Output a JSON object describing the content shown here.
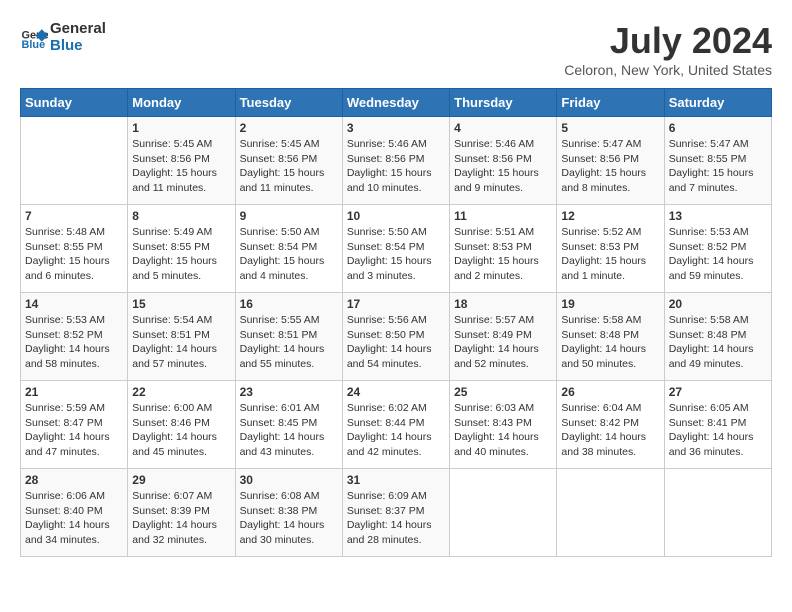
{
  "header": {
    "logo_line1": "General",
    "logo_line2": "Blue",
    "title": "July 2024",
    "location": "Celoron, New York, United States"
  },
  "weekdays": [
    "Sunday",
    "Monday",
    "Tuesday",
    "Wednesday",
    "Thursday",
    "Friday",
    "Saturday"
  ],
  "weeks": [
    [
      {
        "day": "",
        "sunrise": "",
        "sunset": "",
        "daylight": ""
      },
      {
        "day": "1",
        "sunrise": "Sunrise: 5:45 AM",
        "sunset": "Sunset: 8:56 PM",
        "daylight": "Daylight: 15 hours and 11 minutes."
      },
      {
        "day": "2",
        "sunrise": "Sunrise: 5:45 AM",
        "sunset": "Sunset: 8:56 PM",
        "daylight": "Daylight: 15 hours and 11 minutes."
      },
      {
        "day": "3",
        "sunrise": "Sunrise: 5:46 AM",
        "sunset": "Sunset: 8:56 PM",
        "daylight": "Daylight: 15 hours and 10 minutes."
      },
      {
        "day": "4",
        "sunrise": "Sunrise: 5:46 AM",
        "sunset": "Sunset: 8:56 PM",
        "daylight": "Daylight: 15 hours and 9 minutes."
      },
      {
        "day": "5",
        "sunrise": "Sunrise: 5:47 AM",
        "sunset": "Sunset: 8:56 PM",
        "daylight": "Daylight: 15 hours and 8 minutes."
      },
      {
        "day": "6",
        "sunrise": "Sunrise: 5:47 AM",
        "sunset": "Sunset: 8:55 PM",
        "daylight": "Daylight: 15 hours and 7 minutes."
      }
    ],
    [
      {
        "day": "7",
        "sunrise": "Sunrise: 5:48 AM",
        "sunset": "Sunset: 8:55 PM",
        "daylight": "Daylight: 15 hours and 6 minutes."
      },
      {
        "day": "8",
        "sunrise": "Sunrise: 5:49 AM",
        "sunset": "Sunset: 8:55 PM",
        "daylight": "Daylight: 15 hours and 5 minutes."
      },
      {
        "day": "9",
        "sunrise": "Sunrise: 5:50 AM",
        "sunset": "Sunset: 8:54 PM",
        "daylight": "Daylight: 15 hours and 4 minutes."
      },
      {
        "day": "10",
        "sunrise": "Sunrise: 5:50 AM",
        "sunset": "Sunset: 8:54 PM",
        "daylight": "Daylight: 15 hours and 3 minutes."
      },
      {
        "day": "11",
        "sunrise": "Sunrise: 5:51 AM",
        "sunset": "Sunset: 8:53 PM",
        "daylight": "Daylight: 15 hours and 2 minutes."
      },
      {
        "day": "12",
        "sunrise": "Sunrise: 5:52 AM",
        "sunset": "Sunset: 8:53 PM",
        "daylight": "Daylight: 15 hours and 1 minute."
      },
      {
        "day": "13",
        "sunrise": "Sunrise: 5:53 AM",
        "sunset": "Sunset: 8:52 PM",
        "daylight": "Daylight: 14 hours and 59 minutes."
      }
    ],
    [
      {
        "day": "14",
        "sunrise": "Sunrise: 5:53 AM",
        "sunset": "Sunset: 8:52 PM",
        "daylight": "Daylight: 14 hours and 58 minutes."
      },
      {
        "day": "15",
        "sunrise": "Sunrise: 5:54 AM",
        "sunset": "Sunset: 8:51 PM",
        "daylight": "Daylight: 14 hours and 57 minutes."
      },
      {
        "day": "16",
        "sunrise": "Sunrise: 5:55 AM",
        "sunset": "Sunset: 8:51 PM",
        "daylight": "Daylight: 14 hours and 55 minutes."
      },
      {
        "day": "17",
        "sunrise": "Sunrise: 5:56 AM",
        "sunset": "Sunset: 8:50 PM",
        "daylight": "Daylight: 14 hours and 54 minutes."
      },
      {
        "day": "18",
        "sunrise": "Sunrise: 5:57 AM",
        "sunset": "Sunset: 8:49 PM",
        "daylight": "Daylight: 14 hours and 52 minutes."
      },
      {
        "day": "19",
        "sunrise": "Sunrise: 5:58 AM",
        "sunset": "Sunset: 8:48 PM",
        "daylight": "Daylight: 14 hours and 50 minutes."
      },
      {
        "day": "20",
        "sunrise": "Sunrise: 5:58 AM",
        "sunset": "Sunset: 8:48 PM",
        "daylight": "Daylight: 14 hours and 49 minutes."
      }
    ],
    [
      {
        "day": "21",
        "sunrise": "Sunrise: 5:59 AM",
        "sunset": "Sunset: 8:47 PM",
        "daylight": "Daylight: 14 hours and 47 minutes."
      },
      {
        "day": "22",
        "sunrise": "Sunrise: 6:00 AM",
        "sunset": "Sunset: 8:46 PM",
        "daylight": "Daylight: 14 hours and 45 minutes."
      },
      {
        "day": "23",
        "sunrise": "Sunrise: 6:01 AM",
        "sunset": "Sunset: 8:45 PM",
        "daylight": "Daylight: 14 hours and 43 minutes."
      },
      {
        "day": "24",
        "sunrise": "Sunrise: 6:02 AM",
        "sunset": "Sunset: 8:44 PM",
        "daylight": "Daylight: 14 hours and 42 minutes."
      },
      {
        "day": "25",
        "sunrise": "Sunrise: 6:03 AM",
        "sunset": "Sunset: 8:43 PM",
        "daylight": "Daylight: 14 hours and 40 minutes."
      },
      {
        "day": "26",
        "sunrise": "Sunrise: 6:04 AM",
        "sunset": "Sunset: 8:42 PM",
        "daylight": "Daylight: 14 hours and 38 minutes."
      },
      {
        "day": "27",
        "sunrise": "Sunrise: 6:05 AM",
        "sunset": "Sunset: 8:41 PM",
        "daylight": "Daylight: 14 hours and 36 minutes."
      }
    ],
    [
      {
        "day": "28",
        "sunrise": "Sunrise: 6:06 AM",
        "sunset": "Sunset: 8:40 PM",
        "daylight": "Daylight: 14 hours and 34 minutes."
      },
      {
        "day": "29",
        "sunrise": "Sunrise: 6:07 AM",
        "sunset": "Sunset: 8:39 PM",
        "daylight": "Daylight: 14 hours and 32 minutes."
      },
      {
        "day": "30",
        "sunrise": "Sunrise: 6:08 AM",
        "sunset": "Sunset: 8:38 PM",
        "daylight": "Daylight: 14 hours and 30 minutes."
      },
      {
        "day": "31",
        "sunrise": "Sunrise: 6:09 AM",
        "sunset": "Sunset: 8:37 PM",
        "daylight": "Daylight: 14 hours and 28 minutes."
      },
      {
        "day": "",
        "sunrise": "",
        "sunset": "",
        "daylight": ""
      },
      {
        "day": "",
        "sunrise": "",
        "sunset": "",
        "daylight": ""
      },
      {
        "day": "",
        "sunrise": "",
        "sunset": "",
        "daylight": ""
      }
    ]
  ]
}
